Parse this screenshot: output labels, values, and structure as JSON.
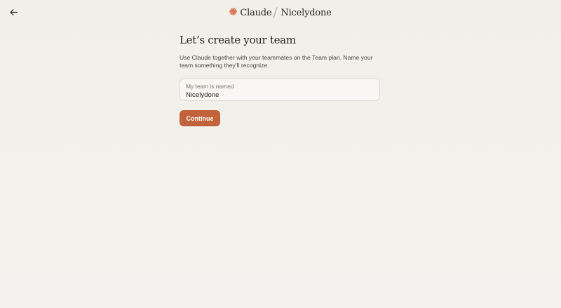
{
  "header": {
    "brand_name": "Claude",
    "org_name": "Nicelydone"
  },
  "icons": {
    "back": "arrow-left-icon",
    "brand": "claude-starburst-icon"
  },
  "main": {
    "title": "Let’s create your team",
    "description": "Use Claude together with your teammates on the Team plan. Name your team something they’ll recognize.",
    "team_field": {
      "label": "My team is named",
      "value": "Nicelydone"
    },
    "continue_label": "Continue"
  },
  "colors": {
    "accent": "#c0623a",
    "background": "#f2f0eb",
    "brand_mark": "#d97757"
  }
}
